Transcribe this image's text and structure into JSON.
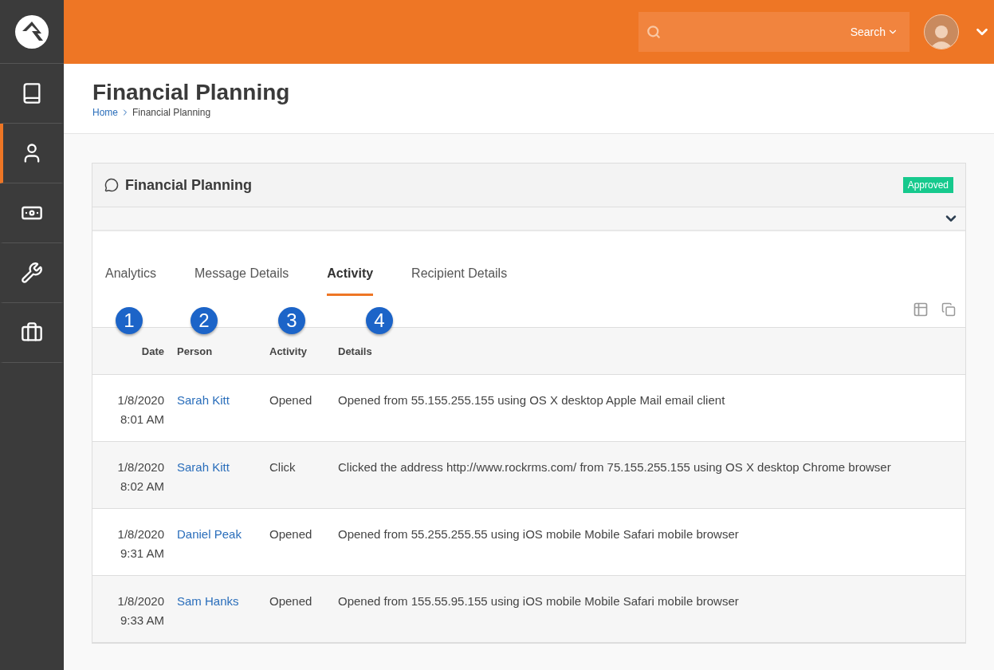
{
  "sidebar": {
    "items": [
      {
        "selected": false
      },
      {
        "selected": true
      },
      {
        "selected": false
      },
      {
        "selected": false
      },
      {
        "selected": false
      }
    ]
  },
  "header": {
    "search": {
      "button": "Search"
    }
  },
  "page": {
    "title": "Financial Planning",
    "breadcrumb": [
      "Home",
      "Financial Planning"
    ]
  },
  "panel": {
    "title": "Financial Planning",
    "badge": "Approved",
    "tabs": [
      {
        "label": "Analytics",
        "selected": false
      },
      {
        "label": "Message Details",
        "selected": false
      },
      {
        "label": "Activity",
        "selected": true
      },
      {
        "label": "Recipient Details",
        "selected": false
      }
    ],
    "callouts": [
      "1",
      "2",
      "3",
      "4"
    ],
    "table": {
      "columns": [
        "Date",
        "Person",
        "Activity",
        "Details"
      ],
      "rows": [
        {
          "date": "1/8/2020",
          "time": "8:01 AM",
          "person": "Sarah Kitt",
          "activity": "Opened",
          "details": "Opened from 55.155.255.155 using OS X desktop Apple Mail email client"
        },
        {
          "date": "1/8/2020",
          "time": "8:02 AM",
          "person": "Sarah Kitt",
          "activity": "Click",
          "details": "Clicked the address http://www.rockrms.com/ from 75.155.255.155 using OS X desktop Chrome browser"
        },
        {
          "date": "1/8/2020",
          "time": "9:31 AM",
          "person": "Daniel Peak",
          "activity": "Opened",
          "details": "Opened from 55.255.255.55 using iOS mobile Mobile Safari mobile browser"
        },
        {
          "date": "1/8/2020",
          "time": "9:33 AM",
          "person": "Sam Hanks",
          "activity": "Opened",
          "details": "Opened from 155.55.95.155 using iOS mobile Mobile Safari mobile browser"
        }
      ]
    }
  }
}
